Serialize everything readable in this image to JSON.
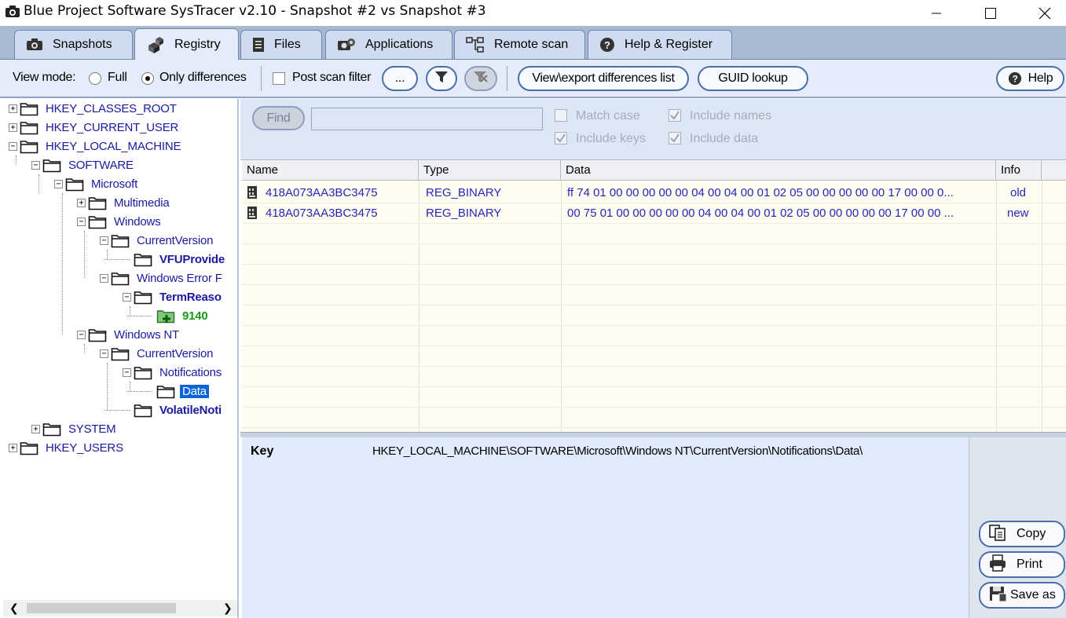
{
  "window": {
    "title": "Blue Project Software SysTracer v2.10 - Snapshot #2 vs Snapshot #3"
  },
  "tabs": [
    {
      "label": "Snapshots",
      "icon": "camera-icon"
    },
    {
      "label": "Registry",
      "icon": "registry-cubes-icon"
    },
    {
      "label": "Files",
      "icon": "file-icon"
    },
    {
      "label": "Applications",
      "icon": "applications-icon"
    },
    {
      "label": "Remote scan",
      "icon": "network-icon"
    },
    {
      "label": "Help & Register",
      "icon": "help-icon"
    }
  ],
  "active_tab": "Registry",
  "toolbar": {
    "view_mode_label": "View mode:",
    "full_label": "Full",
    "only_diff_label": "Only differences",
    "post_scan_label": "Post scan filter",
    "dots_label": "...",
    "view_export_label": "View\\export differences list",
    "guid_label": "GUID lookup",
    "help_label": "Help"
  },
  "tree": {
    "nodes": [
      {
        "label": "HKEY_CLASSES_ROOT"
      },
      {
        "label": "HKEY_CURRENT_USER"
      },
      {
        "label": "HKEY_LOCAL_MACHINE"
      },
      {
        "label": "SOFTWARE"
      },
      {
        "label": "Microsoft"
      },
      {
        "label": "Multimedia"
      },
      {
        "label": "Windows"
      },
      {
        "label": "CurrentVersion"
      },
      {
        "label": "VFUProvide"
      },
      {
        "label": "Windows Error F"
      },
      {
        "label": "TermReaso"
      },
      {
        "label": "9140"
      },
      {
        "label": "Windows NT"
      },
      {
        "label": "CurrentVersion"
      },
      {
        "label": "Notifications"
      },
      {
        "label": "Data"
      },
      {
        "label": "VolatileNoti"
      },
      {
        "label": "SYSTEM"
      },
      {
        "label": "HKEY_USERS"
      }
    ]
  },
  "find": {
    "button": "Find",
    "value": "",
    "match_case": "Match case",
    "include_names": "Include names",
    "include_keys": "Include keys",
    "include_data": "Include data"
  },
  "grid": {
    "columns": [
      "Name",
      "Type",
      "Data",
      "Info"
    ],
    "rows": [
      {
        "name": "418A073AA3BC3475",
        "type": "REG_BINARY",
        "data": "ff 74 01 00 00 00 00 00 04 00 04 00 01 02 05 00 00 00 00 00 17 00 00 0...",
        "info": "old"
      },
      {
        "name": "418A073AA3BC3475",
        "type": "REG_BINARY",
        "data": "00 75 01 00 00 00 00 00 04 00 04 00 01 02 05 00 00 00 00 00 17 00 00 ...",
        "info": "new"
      }
    ]
  },
  "details": {
    "key_label": "Key",
    "key_value": "HKEY_LOCAL_MACHINE\\SOFTWARE\\Microsoft\\Windows NT\\CurrentVersion\\Notifications\\Data\\"
  },
  "side_buttons": {
    "copy": "Copy",
    "print": "Print",
    "save_as": "Save as"
  },
  "colors": {
    "tab_bar": "#a9b9d2",
    "toolbar": "#e3ecf8",
    "tree_text": "#1a1aa0",
    "selection": "#0a64d8",
    "new_node": "#1b9a1b"
  }
}
